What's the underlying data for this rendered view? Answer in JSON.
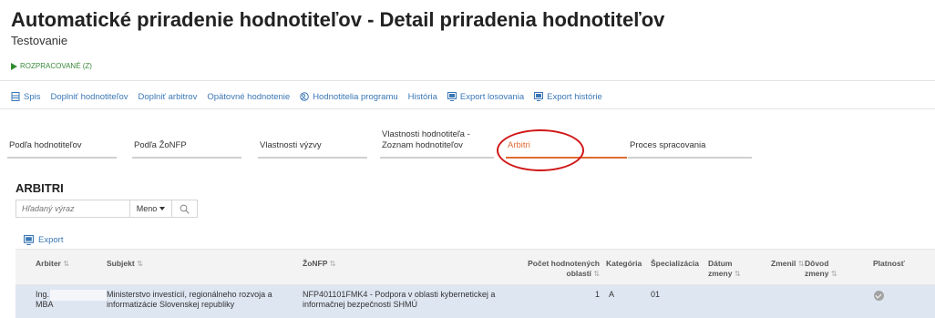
{
  "page": {
    "title": "Automatické priradenie hodnotiteľov - Detail priradenia hodnotiteľov",
    "subtitle": "Testovanie",
    "status": "ROZPRACOVANÉ (Z)"
  },
  "toolbar": [
    {
      "label": "Spis",
      "icon": "file-icon"
    },
    {
      "label": "Doplniť hodnotiteľov",
      "icon": ""
    },
    {
      "label": "Doplniť arbitrov",
      "icon": ""
    },
    {
      "label": "Opätovné hodnotenie",
      "icon": ""
    },
    {
      "label": "Hodnotitelia programu",
      "icon": "users-icon"
    },
    {
      "label": "História",
      "icon": ""
    },
    {
      "label": "Export losovania",
      "icon": "export-icon"
    },
    {
      "label": "Export histórie",
      "icon": "export-icon"
    }
  ],
  "tabs": [
    {
      "label": "Podľa hodnotiteľov",
      "active": false
    },
    {
      "label": "Podľa ŽoNFP",
      "active": false
    },
    {
      "label": "Vlastnosti výzvy",
      "active": false
    },
    {
      "label": "Vlastnosti hodnotiteľa - Zoznam hodnotiteľov",
      "active": false
    },
    {
      "label": "Arbitri",
      "active": true
    },
    {
      "label": "Proces spracovania",
      "active": false
    }
  ],
  "section": {
    "title": "ARBITRI",
    "search_placeholder": "Hľadaný výraz",
    "search_field": "Meno",
    "export_label": "Export"
  },
  "table": {
    "headers": {
      "arbiter": "Arbiter",
      "subjekt": "Subjekt",
      "zonfp": "ŽoNFP",
      "pocet_1": "Počet hodnotených",
      "pocet_2": "oblastí",
      "kategoria": "Kategória",
      "specializacia": "Špecializácia",
      "datum_1": "Dátum",
      "datum_2": "zmeny",
      "zmenil": "Zmenil",
      "dovod_1": "Dôvod",
      "dovod_2": "zmeny",
      "platnost": "Platnosť"
    },
    "sort_glyph": "⇅",
    "rows": [
      {
        "arbiter_line1": "Ing.",
        "arbiter_line2": "MBA",
        "subjekt_line1": "Ministerstvo investícií, regionálneho rozvoja a",
        "subjekt_line2": "informatizácie Slovenskej republiky",
        "zonfp_line1": "NFP401101FMK4 - Podpora v oblasti kybernetickej a",
        "zonfp_line2": "informačnej bezpečnosti SHMÚ",
        "pocet": "1",
        "kategoria": "A",
        "specializacia": "01",
        "datum": "",
        "zmenil": "",
        "dovod": "",
        "platnost_icon": "check-circle-icon"
      }
    ]
  },
  "colors": {
    "accent": "#e06a35",
    "link": "#3a77b5",
    "status": "#2e8b2e",
    "annotation": "#d01818",
    "row_bg": "#dee6f2"
  }
}
